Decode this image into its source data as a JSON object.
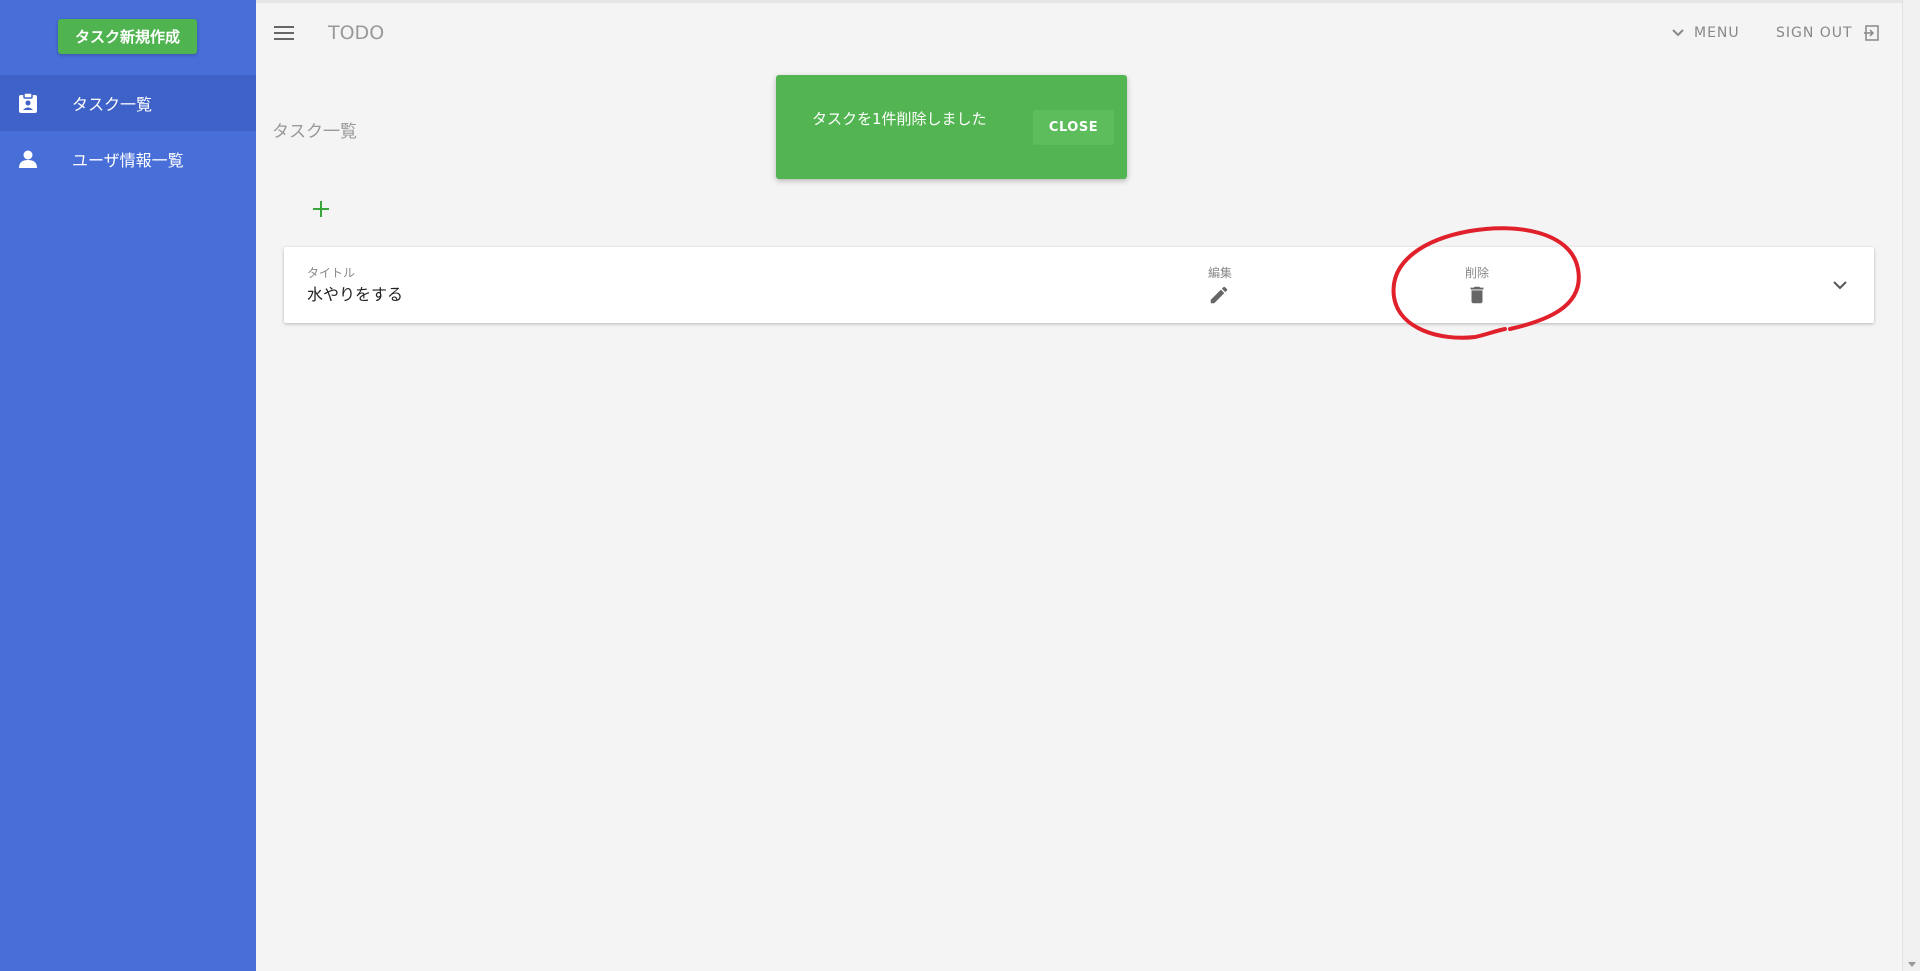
{
  "sidebar": {
    "new_task_label": "タスク新規作成",
    "items": [
      {
        "label": "タスク一覧",
        "icon": "clipboard-icon"
      },
      {
        "label": "ユーザ情報一覧",
        "icon": "person-icon"
      }
    ]
  },
  "header": {
    "title": "TODO",
    "menu_label": "MENU",
    "signout_label": "SIGN OUT"
  },
  "page": {
    "heading": "タスク一覧"
  },
  "task_list": [
    {
      "title_label": "タイトル",
      "title": "水やりをする",
      "edit_label": "編集",
      "delete_label": "削除"
    }
  ],
  "snackbar": {
    "message": "タスクを1件削除しました",
    "close_label": "CLOSE"
  },
  "colors": {
    "sidebar": "#486ed8",
    "accent_green": "#4fb44f",
    "annotation": "#e0202a"
  }
}
